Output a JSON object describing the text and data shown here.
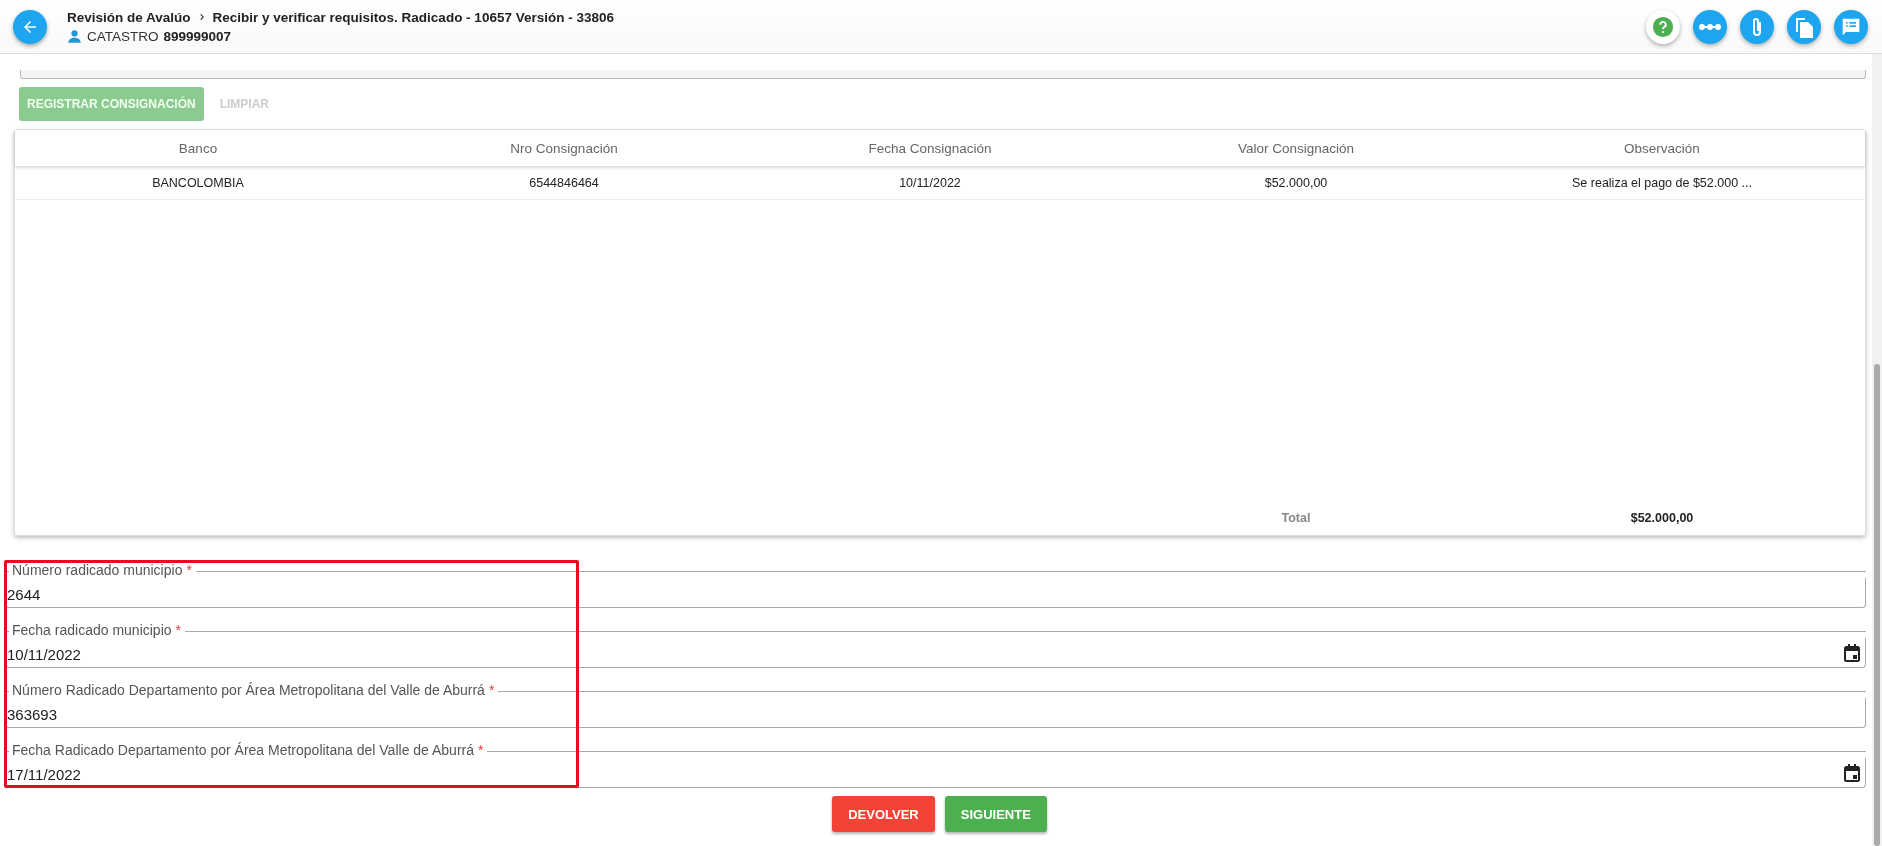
{
  "header": {
    "process": "Revisión de Avalúo",
    "step": "Recibir y verificar requisitos. Radicado - 10657 Versión - 33806",
    "user_role": "CATASTRO",
    "user_id": "899999007"
  },
  "actions": [
    {
      "label": "REGISTRAR CONSIGNACIÓN",
      "kind": "primary",
      "disabled": true
    },
    {
      "label": "LIMPIAR",
      "kind": "flat",
      "disabled": true
    }
  ],
  "table": {
    "columns": [
      "Banco",
      "Nro Consignación",
      "Fecha Consignación",
      "Valor Consignación",
      "Observación"
    ],
    "rows": [
      [
        "BANCOLOMBIA",
        "6544846464",
        "10/11/2022",
        "$52.000,00",
        "Se realiza el pago de $52.000 ..."
      ]
    ],
    "total_label": "Total",
    "total_value": "$52.000,00"
  },
  "fields": [
    {
      "label": "Número radicado municipio",
      "required_mark": "*",
      "value": "2644",
      "kind": "text"
    },
    {
      "label": "Fecha radicado municipio",
      "required_mark": "*",
      "value": "10/11/2022",
      "kind": "date"
    },
    {
      "label": "Número Radicado Departamento por Área Metropolitana del Valle de Aburrá",
      "required_mark": "*",
      "value": "363693",
      "kind": "text"
    },
    {
      "label": "Fecha Radicado Departamento por Área Metropolitana del Valle de Aburrá",
      "required_mark": "*",
      "value": "17/11/2022",
      "kind": "date"
    }
  ],
  "footer_buttons": [
    {
      "label": "DEVOLVER",
      "kind": "danger"
    },
    {
      "label": "SIGUIENTE",
      "kind": "success"
    }
  ]
}
